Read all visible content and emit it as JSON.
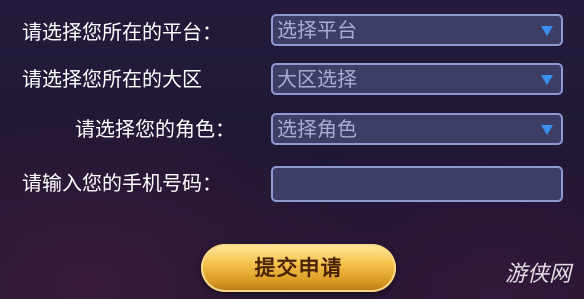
{
  "form": {
    "platform": {
      "label": "请选择您所在的平台：",
      "value": "选择平台"
    },
    "region": {
      "label": "请选择您所在的大区",
      "value": "大区选择"
    },
    "role": {
      "label": "请选择您的角色：",
      "value": "选择角色"
    },
    "phone": {
      "label": "请输入您的手机号码：",
      "value": ""
    }
  },
  "submit_label": "提交申请",
  "watermark": "游侠网",
  "colors": {
    "accent_caret": "#3a8ff0",
    "field_border": "#8e9ad1",
    "button_gold": "#f6c24e"
  },
  "icons": {
    "dropdown": "triangle-down"
  }
}
